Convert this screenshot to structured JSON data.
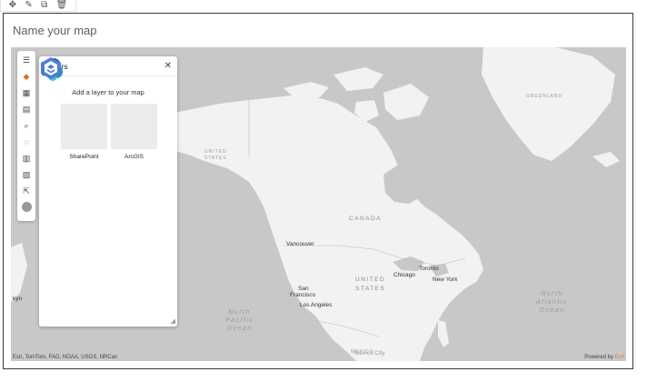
{
  "toolbar": {
    "icons": [
      "move-icon",
      "edit-icon",
      "copy-icon",
      "delete-icon"
    ],
    "move_glyph": "✥",
    "edit_glyph": "✎",
    "copy_glyph": "⧉",
    "delete_glyph": "🗑"
  },
  "card": {
    "title": "Name your map"
  },
  "rail": {
    "menu_glyph": "☰",
    "layers_glyph": "◆",
    "basemap_glyph": "▦",
    "legend_glyph": "▤",
    "search_glyph": "⌕",
    "locate_glyph": "◌",
    "chart_glyph": "▥",
    "map_glyph": "▨",
    "share_glyph": "⇱"
  },
  "layers_panel": {
    "title": "Layers",
    "close_glyph": "✕",
    "subtitle": "Add a layer to your map",
    "sources": [
      {
        "label": "SharePoint"
      },
      {
        "label": "ArcGIS"
      }
    ],
    "resize_glyph": "◢"
  },
  "map": {
    "countries": {
      "canada": "CANADA",
      "united_states_1": "UNITED",
      "united_states_2": "STATES",
      "greenland": "GREENLAND",
      "us_small_1": "UNITED",
      "us_small_2": "STATES",
      "mexico": "MEXICO"
    },
    "cities": {
      "vancouver": "Vancouver",
      "chicago": "Chicago",
      "toronto": "Toronto",
      "new_york": "New York",
      "san_francisco_1": "San",
      "san_francisco_2": "Francisco",
      "los_angeles": "Los Angeles",
      "mexico_city": "Mexico City",
      "tokyo": "kyo"
    },
    "oceans": {
      "north_pacific_1": "North",
      "north_pacific_2": "Pacific",
      "north_pacific_3": "Ocean",
      "north_atlantic_1": "North",
      "north_atlantic_2": "Atlantic",
      "north_atlantic_3": "Ocean"
    },
    "attribution": "Esri, TomTom, FAO, NOAA, USGS, NRCan",
    "powered_by": "Powered by",
    "powered_brand": "Esri"
  },
  "colors": {
    "water": "#c8c8c8",
    "land": "#f2f2f2",
    "accent": "#d9731c",
    "sharepoint": "#0b6a70",
    "arcgis": "#3b6fd8"
  }
}
